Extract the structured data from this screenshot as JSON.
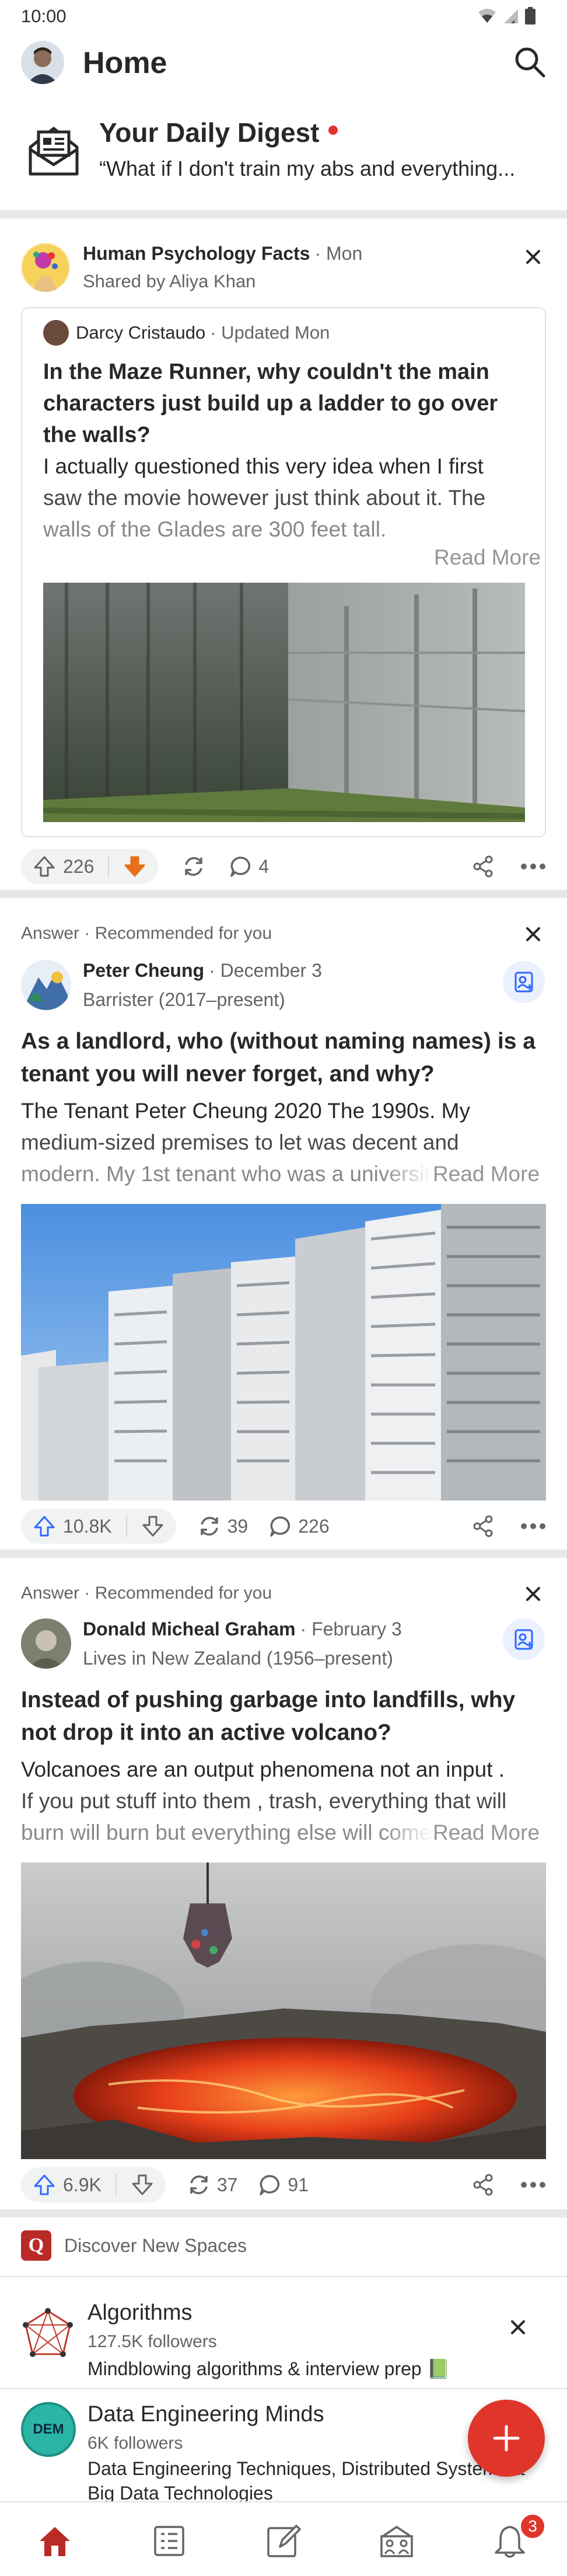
{
  "status_bar": {
    "time": "10:00"
  },
  "header": {
    "title": "Home"
  },
  "digest": {
    "title": "Your Daily Digest",
    "subtitle": "“What if I don't train my abs and everything..."
  },
  "post1": {
    "space_name": "Human Psychology Facts",
    "space_time": "· Mon",
    "shared_by": "Shared by Aliya Khan",
    "author": "Darcy Cristaudo",
    "author_meta": "· Updated Mon",
    "question": "In the Maze Runner, why couldn't the main characters just build up a ladder to go over the walls?",
    "body_lines": [
      "I actually questioned this very idea when I first",
      "saw the movie however just think about it. The",
      "walls of the Glades are 300 feet tall."
    ],
    "read_more": "Read More",
    "upvotes": "226",
    "comments": "4"
  },
  "post2": {
    "tag": "Answer · Recommended for you",
    "author": "Peter Cheung",
    "date": "· December 3",
    "credential": "Barrister (2017–present)",
    "question": "As a landlord, who (without naming names) is a tenant you will never forget, and why?",
    "body_lines": [
      "The Tenant Peter Cheung 2020 The 1990s. My",
      "medium-sized premises to let was decent and",
      "modern. My 1st tenant who was a university"
    ],
    "read_more": "Read More",
    "upvotes": "10.8K",
    "shares": "39",
    "comments": "226"
  },
  "post3": {
    "tag": "Answer · Recommended for you",
    "author": "Donald Micheal Graham",
    "date": "· February 3",
    "credential": "Lives in New Zealand (1956–present)",
    "question": "Instead of pushing garbage into landfills, why not drop it into an active volcano?",
    "body_lines": [
      "Volcanoes are an output phenomena not an input .",
      "If you put stuff into them , trash, everything that will",
      "burn will burn but everything else will come"
    ],
    "read_more": "Read More",
    "upvotes": "6.9K",
    "shares": "37",
    "comments": "91"
  },
  "spaces": {
    "header": "Discover New Spaces",
    "items": [
      {
        "name": "Algorithms",
        "followers": "127.5K followers",
        "desc": "Mindblowing algorithms & interview prep 📗"
      },
      {
        "name": "Data Engineering Minds",
        "followers": "6K followers",
        "desc": "Data Engineering Techniques, Distributed Systems &",
        "desc2": "Big Data Technologies",
        "logo_text": "DEM"
      }
    ]
  },
  "bottom_nav": {
    "notification_count": "3"
  },
  "colors": {
    "accent": "#b92b27",
    "upvote_blue": "#2e69ff",
    "downvote_orange": "#e86f1c",
    "fab": "#e0352b"
  }
}
